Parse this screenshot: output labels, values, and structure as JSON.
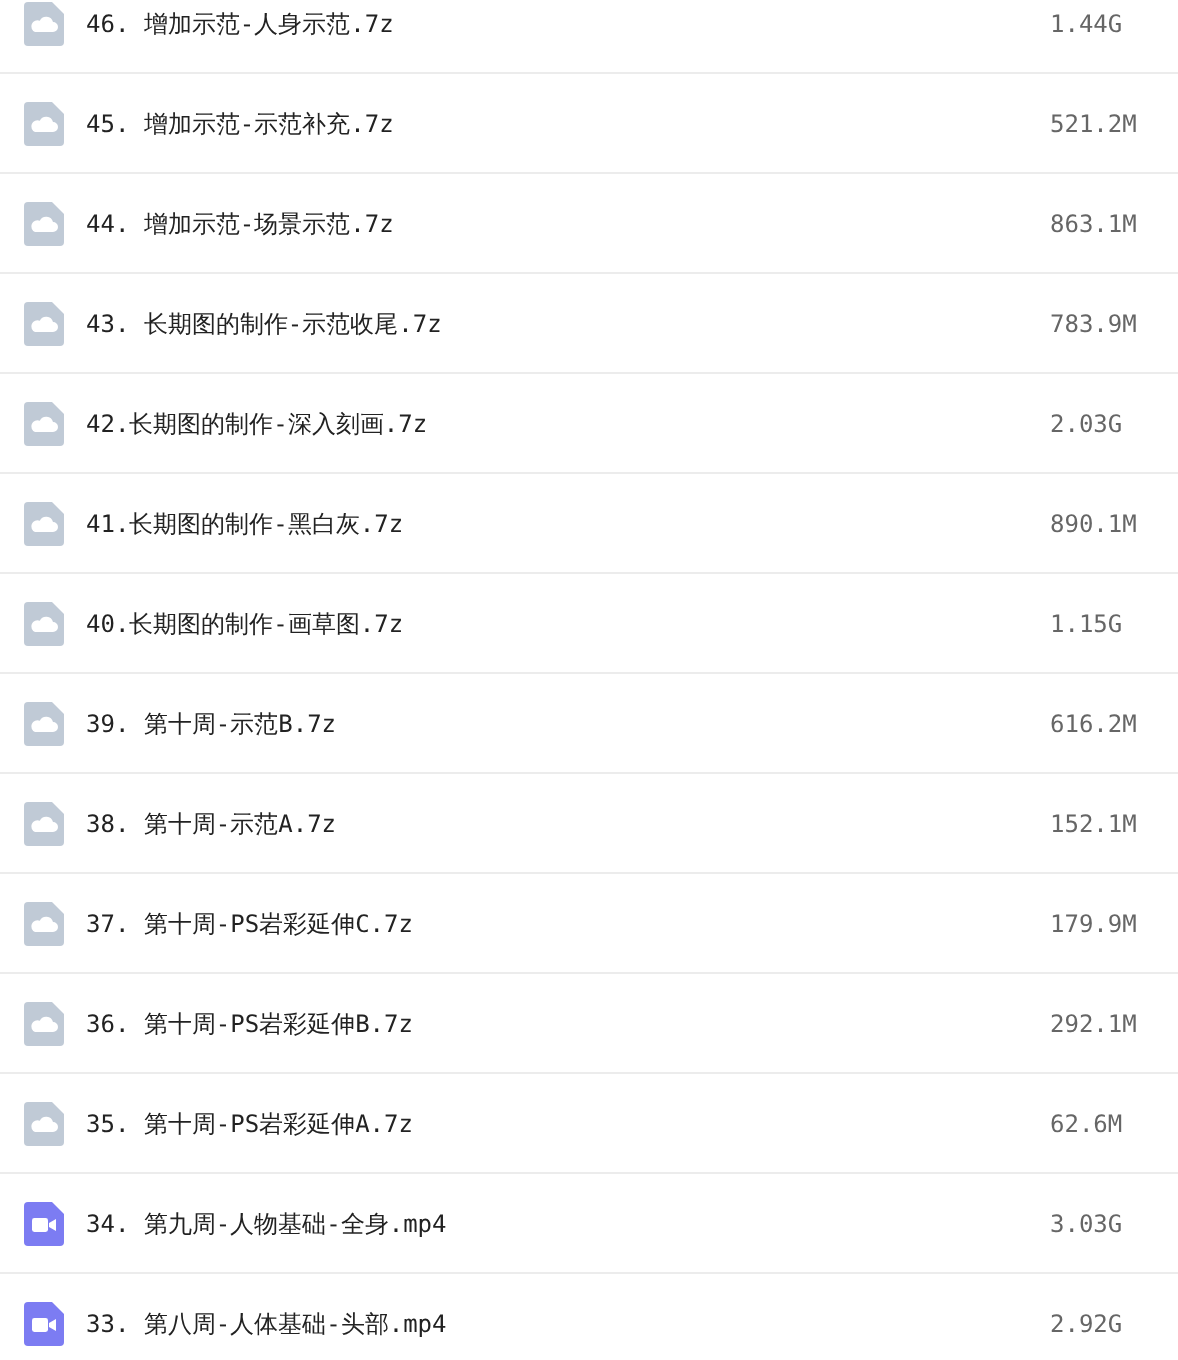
{
  "files": [
    {
      "kind": "archive",
      "name": "46. 增加示范-人身示范.7z",
      "size": "1.44G"
    },
    {
      "kind": "archive",
      "name": "45. 增加示范-示范补充.7z",
      "size": "521.2M"
    },
    {
      "kind": "archive",
      "name": "44. 增加示范-场景示范.7z",
      "size": "863.1M"
    },
    {
      "kind": "archive",
      "name": "43. 长期图的制作-示范收尾.7z",
      "size": "783.9M"
    },
    {
      "kind": "archive",
      "name": "42.长期图的制作-深入刻画.7z",
      "size": "2.03G"
    },
    {
      "kind": "archive",
      "name": "41.长期图的制作-黑白灰.7z",
      "size": "890.1M"
    },
    {
      "kind": "archive",
      "name": "40.长期图的制作-画草图.7z",
      "size": "1.15G"
    },
    {
      "kind": "archive",
      "name": "39. 第十周-示范B.7z",
      "size": "616.2M"
    },
    {
      "kind": "archive",
      "name": "38. 第十周-示范A.7z",
      "size": "152.1M"
    },
    {
      "kind": "archive",
      "name": "37. 第十周-PS岩彩延伸C.7z",
      "size": "179.9M"
    },
    {
      "kind": "archive",
      "name": "36. 第十周-PS岩彩延伸B.7z",
      "size": "292.1M"
    },
    {
      "kind": "archive",
      "name": "35. 第十周-PS岩彩延伸A.7z",
      "size": "62.6M"
    },
    {
      "kind": "video",
      "name": "34. 第九周-人物基础-全身.mp4",
      "size": "3.03G"
    },
    {
      "kind": "video",
      "name": "33. 第八周-人体基础-头部.mp4",
      "size": "2.92G"
    }
  ]
}
